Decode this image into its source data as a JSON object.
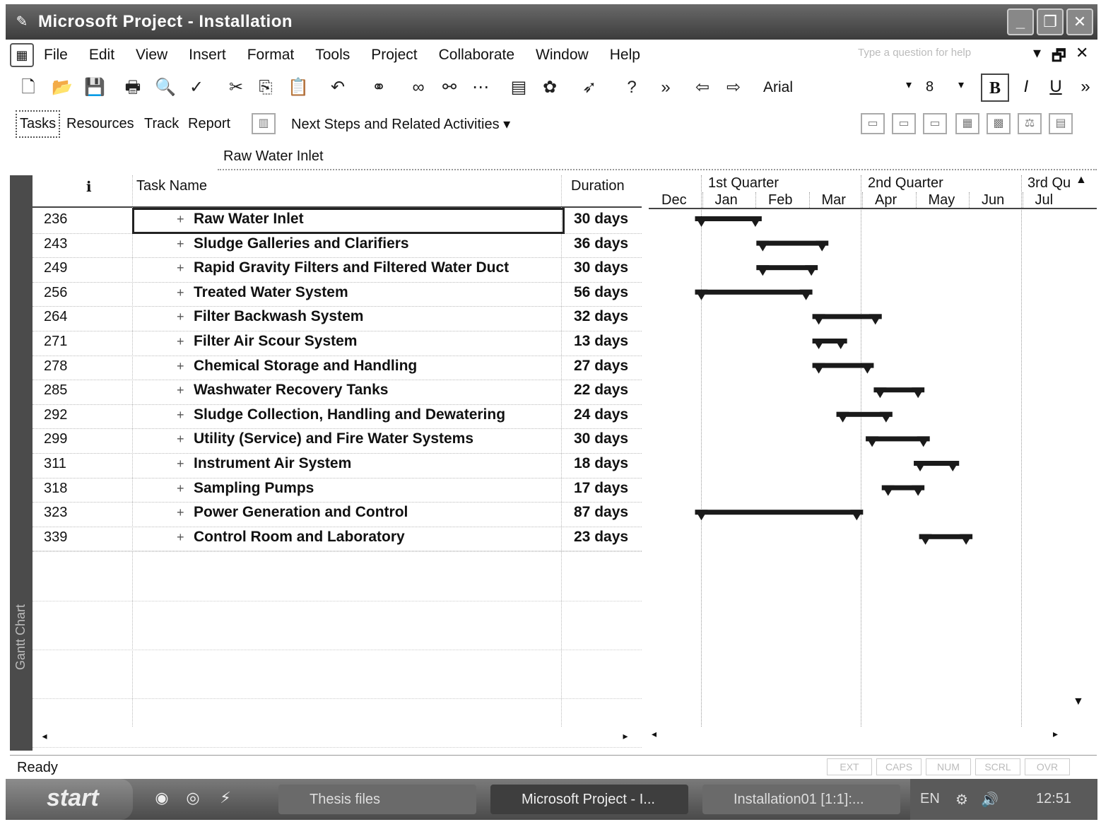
{
  "window": {
    "title": "Microsoft Project - Installation",
    "min": "_",
    "max": "❐",
    "close": "✕"
  },
  "menu": {
    "items": [
      "File",
      "Edit",
      "View",
      "Insert",
      "Format",
      "Tools",
      "Project",
      "Collaborate",
      "Window",
      "Help"
    ],
    "question_placeholder": "Type a question for help",
    "doc_controls": [
      "▾",
      "🗗",
      "✕"
    ]
  },
  "toolbar": {
    "font_name": "Arial",
    "font_size": "8",
    "bold_label": "B",
    "italic_label": "I",
    "underline_label": "U",
    "more": "»"
  },
  "guide": {
    "tabs": [
      "Tasks",
      "Resources",
      "Track",
      "Report"
    ],
    "active_tab": "Tasks",
    "next_steps": "Next Steps and Related Activities ▾"
  },
  "entry_bar": {
    "value": "Raw Water Inlet"
  },
  "view_bar": {
    "label": "Gantt Chart"
  },
  "table": {
    "columns": {
      "indicators": "ℹ",
      "task_name": "Task Name",
      "duration": "Duration"
    },
    "rows": [
      {
        "id": "236",
        "name": "Raw Water Inlet",
        "duration": "30 days"
      },
      {
        "id": "243",
        "name": "Sludge Galleries and Clarifiers",
        "duration": "36 days"
      },
      {
        "id": "249",
        "name": "Rapid Gravity Filters and Filtered Water Duct",
        "duration": "30 days"
      },
      {
        "id": "256",
        "name": "Treated Water System",
        "duration": "56 days"
      },
      {
        "id": "264",
        "name": "Filter Backwash System",
        "duration": "32 days"
      },
      {
        "id": "271",
        "name": "Filter Air Scour System",
        "duration": "13 days"
      },
      {
        "id": "278",
        "name": "Chemical Storage and Handling",
        "duration": "27 days"
      },
      {
        "id": "285",
        "name": "Washwater Recovery Tanks",
        "duration": "22 days"
      },
      {
        "id": "292",
        "name": "Sludge Collection, Handling and Dewatering",
        "duration": "24 days"
      },
      {
        "id": "299",
        "name": "Utility (Service) and Fire Water Systems",
        "duration": "30 days"
      },
      {
        "id": "311",
        "name": "Instrument Air System",
        "duration": "18 days"
      },
      {
        "id": "318",
        "name": "Sampling Pumps",
        "duration": "17 days"
      },
      {
        "id": "323",
        "name": "Power Generation and Control",
        "duration": "87 days"
      },
      {
        "id": "339",
        "name": "Control Room and Laboratory",
        "duration": "23 days"
      }
    ],
    "selected_row": 0
  },
  "gantt": {
    "quarters": [
      "1st Quarter",
      "2nd Quarter",
      "3rd Qu"
    ],
    "months": [
      "Dec",
      "Jan",
      "Feb",
      "Mar",
      "Apr",
      "May",
      "Jun",
      "Jul"
    ],
    "timeline_start_month_index": 0,
    "bars": [
      {
        "start": 1.0,
        "end": 2.25
      },
      {
        "start": 2.15,
        "end": 3.5
      },
      {
        "start": 2.15,
        "end": 3.3
      },
      {
        "start": 1.0,
        "end": 3.2
      },
      {
        "start": 3.2,
        "end": 4.5
      },
      {
        "start": 3.2,
        "end": 3.85
      },
      {
        "start": 3.2,
        "end": 4.35
      },
      {
        "start": 4.35,
        "end": 5.3
      },
      {
        "start": 3.65,
        "end": 4.7
      },
      {
        "start": 4.2,
        "end": 5.4
      },
      {
        "start": 5.1,
        "end": 5.95
      },
      {
        "start": 4.5,
        "end": 5.3
      },
      {
        "start": 1.0,
        "end": 4.15
      },
      {
        "start": 5.2,
        "end": 6.2
      }
    ]
  },
  "status": {
    "ready": "Ready",
    "indicators": [
      "EXT",
      "CAPS",
      "NUM",
      "SCRL",
      "OVR"
    ]
  },
  "taskbar": {
    "start": "start",
    "tasks": [
      "Thesis files",
      "Microsoft Project - I...",
      "Installation01 [1:1]:..."
    ],
    "lang": "EN",
    "clock": "12:51"
  }
}
